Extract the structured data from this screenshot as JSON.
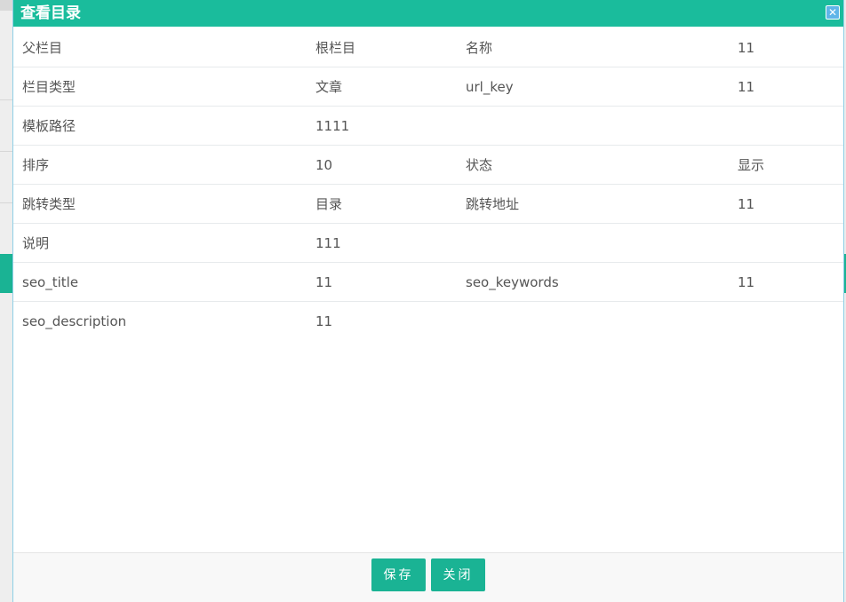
{
  "dialog": {
    "title": "查看目录",
    "close_icon": "close-icon"
  },
  "rows": [
    {
      "label1": "父栏目",
      "value1": "根栏目",
      "label2": "名称",
      "value2": "11"
    },
    {
      "label1": "栏目类型",
      "value1": "文章",
      "label2": "url_key",
      "value2": "11"
    },
    {
      "label1": "模板路径",
      "value1": "1111",
      "label2": "",
      "value2": ""
    },
    {
      "label1": "排序",
      "value1": "10",
      "label2": "状态",
      "value2": "显示"
    },
    {
      "label1": "跳转类型",
      "value1": "目录",
      "label2": "跳转地址",
      "value2": "11"
    },
    {
      "label1": "说明",
      "value1": "111",
      "label2": "",
      "value2": ""
    },
    {
      "label1": "seo_title",
      "value1": "11",
      "label2": "seo_keywords",
      "value2": "11"
    },
    {
      "label1": "seo_description",
      "value1": "11",
      "label2": "",
      "value2": ""
    }
  ],
  "footer": {
    "save_label": "保存",
    "close_label": "关闭"
  },
  "colors": {
    "accent": "#1abc9c",
    "button": "#1ab394"
  }
}
